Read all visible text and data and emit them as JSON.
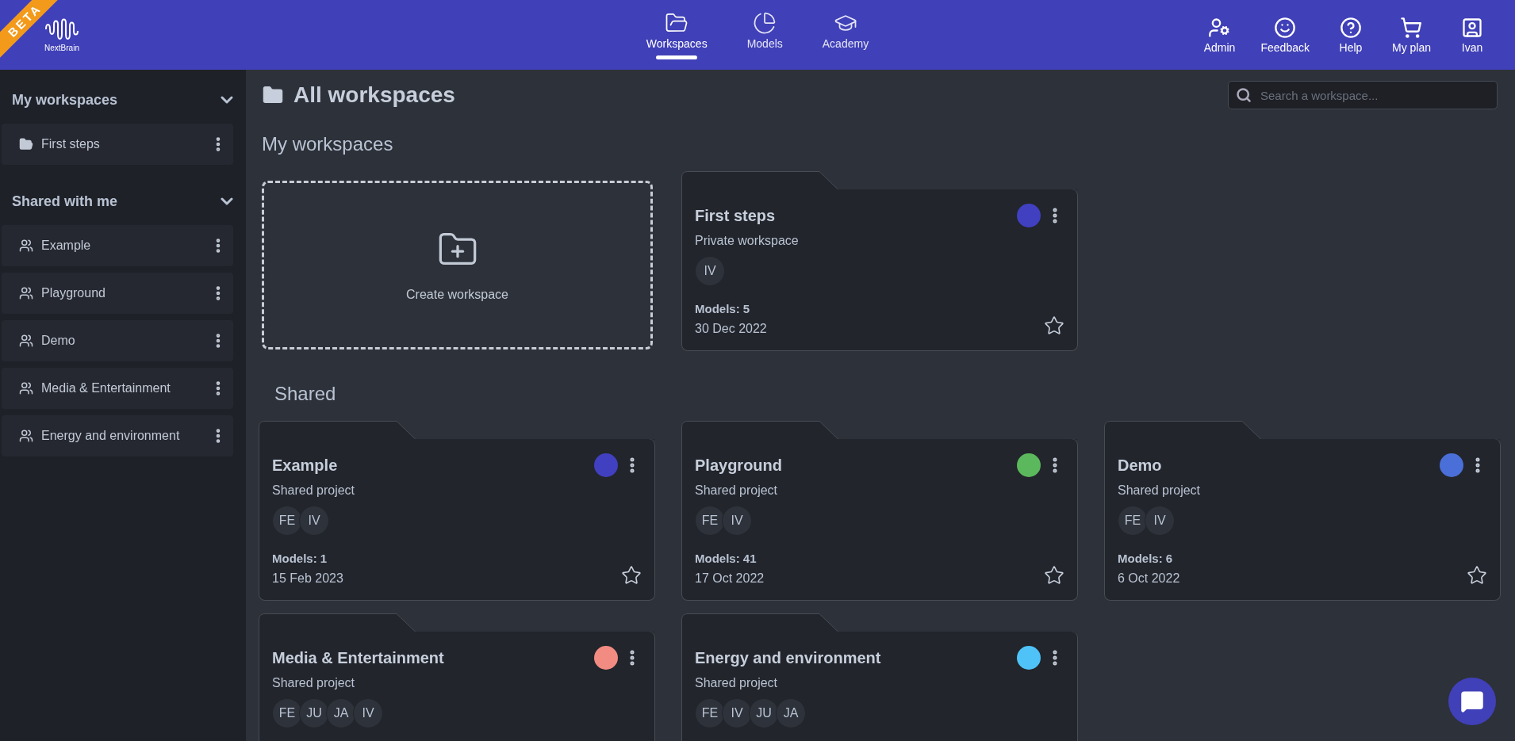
{
  "brand": {
    "name": "NextBrain",
    "ribbon": "BETA"
  },
  "nav": [
    {
      "label": "Workspaces",
      "selected": true
    },
    {
      "label": "Models",
      "selected": false
    },
    {
      "label": "Academy",
      "selected": false
    }
  ],
  "user_menu": [
    {
      "label": "Admin"
    },
    {
      "label": "Feedback"
    },
    {
      "label": "Help"
    },
    {
      "label": "My plan"
    },
    {
      "label": "Ivan"
    }
  ],
  "sidebar": {
    "sections": [
      {
        "title": "My workspaces",
        "expanded": true,
        "kind": "private",
        "items": [
          "First steps"
        ]
      },
      {
        "title": "Shared with me",
        "expanded": true,
        "kind": "shared",
        "items": [
          "Example",
          "Playground",
          "Demo",
          "Media & Entertainment",
          "Energy and environment"
        ]
      }
    ]
  },
  "page": {
    "title": "All workspaces",
    "search": {
      "placeholder": "Search a workspace..."
    }
  },
  "my_workspaces": {
    "title": "My workspaces",
    "create_label": "Create workspace",
    "cards": [
      {
        "name": "First steps",
        "subtitle": "Private workspace",
        "color": "#4040c0",
        "members": [
          "IV"
        ],
        "models": "Models: 5",
        "date": "30 Dec 2022"
      }
    ]
  },
  "shared": {
    "title": "Shared",
    "cards": [
      {
        "name": "Example",
        "subtitle": "Shared project",
        "color": "#4040c0",
        "members": [
          "FE",
          "IV"
        ],
        "models": "Models: 1",
        "date": "15 Feb 2023"
      },
      {
        "name": "Playground",
        "subtitle": "Shared project",
        "color": "#5cb85c",
        "members": [
          "FE",
          "IV"
        ],
        "models": "Models: 41",
        "date": "17 Oct 2022"
      },
      {
        "name": "Demo",
        "subtitle": "Shared project",
        "color": "#4a6fd8",
        "members": [
          "FE",
          "IV"
        ],
        "models": "Models: 6",
        "date": "6 Oct 2022"
      },
      {
        "name": "Media & Entertainment",
        "subtitle": "Shared project",
        "color": "#f28b82",
        "members": [
          "FE",
          "JU",
          "JA",
          "IV"
        ]
      },
      {
        "name": "Energy and environment",
        "subtitle": "Shared project",
        "color": "#4fc3f7",
        "members": [
          "FE",
          "IV",
          "JU",
          "JA"
        ]
      }
    ]
  }
}
